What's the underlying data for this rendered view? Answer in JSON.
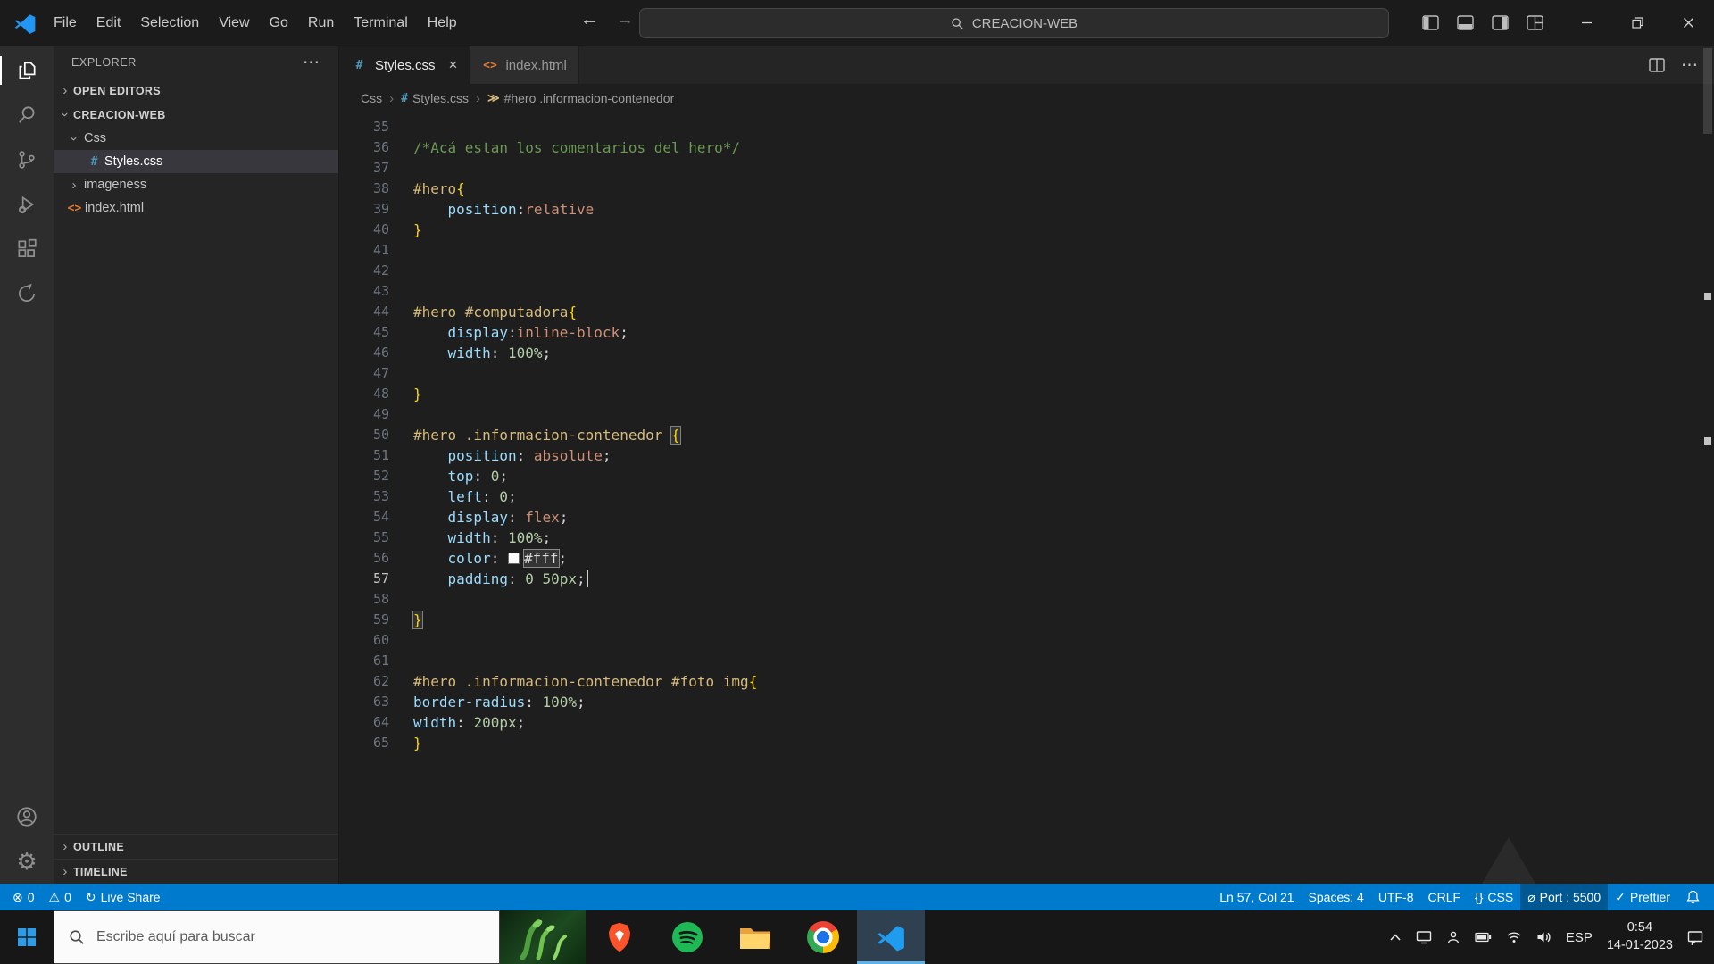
{
  "colors": {
    "status_blue": "#007acc",
    "css_blue": "#519aba",
    "html_orange": "#e37933",
    "selection_gray": "#37373d"
  },
  "icons": {
    "chevron": "›",
    "more": "⋯",
    "close": "×",
    "arrow_left": "←",
    "arrow_right": "→",
    "gear": "⚙",
    "error": "⊗",
    "warning": "⚠",
    "live-share": "↻",
    "braces": "{}",
    "port": "⌀",
    "check": "✓",
    "css-file": "#",
    "html-file": "<>",
    "symbol": "≫"
  },
  "title_bar": {
    "menus": [
      "File",
      "Edit",
      "Selection",
      "View",
      "Go",
      "Run",
      "Terminal",
      "Help"
    ],
    "search_label": "CREACION-WEB"
  },
  "sidebar": {
    "title": "EXPLORER",
    "open_editors_label": "OPEN EDITORS",
    "workspace_label": "CREACION-WEB",
    "tree": [
      {
        "label": "Css",
        "kind": "folder",
        "chevron": "down",
        "depth": 1
      },
      {
        "label": "Styles.css",
        "kind": "css",
        "depth": 2,
        "selected": true
      },
      {
        "label": "imageness",
        "kind": "folder",
        "chevron": "right",
        "depth": 1
      },
      {
        "label": "index.html",
        "kind": "html",
        "depth": 1
      }
    ],
    "bottom_sections": [
      "OUTLINE",
      "TIMELINE"
    ]
  },
  "editor": {
    "tabs": [
      {
        "label": "Styles.css",
        "icon": "css",
        "active": true
      },
      {
        "label": "index.html",
        "icon": "html",
        "active": false
      }
    ],
    "breadcrumb": [
      {
        "label": "Css"
      },
      {
        "label": "Styles.css",
        "icon": "css"
      },
      {
        "label": "#hero .informacion-contenedor",
        "icon": "symbol"
      }
    ],
    "code_lines": [
      {
        "n": 35,
        "tokens": []
      },
      {
        "n": 36,
        "tokens": [
          {
            "s": "cm",
            "t": "/*Acá estan los comentarios del hero*/"
          }
        ]
      },
      {
        "n": 37,
        "tokens": []
      },
      {
        "n": 38,
        "tokens": [
          {
            "s": "sel",
            "t": "#hero"
          },
          {
            "s": "brace",
            "t": "{"
          }
        ]
      },
      {
        "n": 39,
        "tokens": [
          {
            "s": "pln",
            "t": "    "
          },
          {
            "s": "prop",
            "t": "position"
          },
          {
            "s": "punc",
            "t": ":"
          },
          {
            "s": "val",
            "t": "relative"
          }
        ]
      },
      {
        "n": 40,
        "tokens": [
          {
            "s": "brace",
            "t": "}"
          }
        ]
      },
      {
        "n": 41,
        "tokens": []
      },
      {
        "n": 42,
        "tokens": []
      },
      {
        "n": 43,
        "tokens": []
      },
      {
        "n": 44,
        "tokens": [
          {
            "s": "sel",
            "t": "#hero #computadora"
          },
          {
            "s": "brace",
            "t": "{"
          }
        ]
      },
      {
        "n": 45,
        "tokens": [
          {
            "s": "pln",
            "t": "    "
          },
          {
            "s": "prop",
            "t": "display"
          },
          {
            "s": "punc",
            "t": ":"
          },
          {
            "s": "val",
            "t": "inline-block"
          },
          {
            "s": "punc",
            "t": ";"
          }
        ]
      },
      {
        "n": 46,
        "tokens": [
          {
            "s": "pln",
            "t": "    "
          },
          {
            "s": "prop",
            "t": "width"
          },
          {
            "s": "punc",
            "t": ": "
          },
          {
            "s": "num",
            "t": "100%"
          },
          {
            "s": "punc",
            "t": ";"
          }
        ]
      },
      {
        "n": 47,
        "tokens": []
      },
      {
        "n": 48,
        "tokens": [
          {
            "s": "brace",
            "t": "}"
          }
        ]
      },
      {
        "n": 49,
        "tokens": []
      },
      {
        "n": 50,
        "tokens": [
          {
            "s": "sel",
            "t": "#hero .informacion-contenedor "
          },
          {
            "s": "brm",
            "t": "{"
          }
        ]
      },
      {
        "n": 51,
        "tokens": [
          {
            "s": "pln",
            "t": "    "
          },
          {
            "s": "prop",
            "t": "position"
          },
          {
            "s": "punc",
            "t": ": "
          },
          {
            "s": "val",
            "t": "absolute"
          },
          {
            "s": "punc",
            "t": ";"
          }
        ]
      },
      {
        "n": 52,
        "tokens": [
          {
            "s": "pln",
            "t": "    "
          },
          {
            "s": "prop",
            "t": "top"
          },
          {
            "s": "punc",
            "t": ": "
          },
          {
            "s": "num",
            "t": "0"
          },
          {
            "s": "punc",
            "t": ";"
          }
        ]
      },
      {
        "n": 53,
        "tokens": [
          {
            "s": "pln",
            "t": "    "
          },
          {
            "s": "prop",
            "t": "left"
          },
          {
            "s": "punc",
            "t": ": "
          },
          {
            "s": "num",
            "t": "0"
          },
          {
            "s": "punc",
            "t": ";"
          }
        ]
      },
      {
        "n": 54,
        "tokens": [
          {
            "s": "pln",
            "t": "    "
          },
          {
            "s": "prop",
            "t": "display"
          },
          {
            "s": "punc",
            "t": ": "
          },
          {
            "s": "val",
            "t": "flex"
          },
          {
            "s": "punc",
            "t": ";"
          }
        ]
      },
      {
        "n": 55,
        "tokens": [
          {
            "s": "pln",
            "t": "    "
          },
          {
            "s": "prop",
            "t": "width"
          },
          {
            "s": "punc",
            "t": ": "
          },
          {
            "s": "num",
            "t": "100%"
          },
          {
            "s": "punc",
            "t": ";"
          }
        ]
      },
      {
        "n": 56,
        "tokens": [
          {
            "s": "pln",
            "t": "    "
          },
          {
            "s": "prop",
            "t": "color"
          },
          {
            "s": "punc",
            "t": ": "
          },
          {
            "s": "swatch",
            "t": ""
          },
          {
            "s": "hl",
            "t": "#fff"
          },
          {
            "s": "punc",
            "t": ";"
          }
        ]
      },
      {
        "n": 57,
        "active": true,
        "cursor": true,
        "tokens": [
          {
            "s": "pln",
            "t": "    "
          },
          {
            "s": "prop",
            "t": "padding"
          },
          {
            "s": "punc",
            "t": ": "
          },
          {
            "s": "num",
            "t": "0 50px"
          },
          {
            "s": "punc",
            "t": ";"
          }
        ]
      },
      {
        "n": 58,
        "tokens": []
      },
      {
        "n": 59,
        "tokens": [
          {
            "s": "brm",
            "t": "}"
          }
        ]
      },
      {
        "n": 60,
        "tokens": []
      },
      {
        "n": 61,
        "tokens": []
      },
      {
        "n": 62,
        "tokens": [
          {
            "s": "sel",
            "t": "#hero .informacion-contenedor #foto img"
          },
          {
            "s": "brace",
            "t": "{"
          }
        ]
      },
      {
        "n": 63,
        "tokens": [
          {
            "s": "prop",
            "t": "border-radius"
          },
          {
            "s": "punc",
            "t": ": "
          },
          {
            "s": "num",
            "t": "100%"
          },
          {
            "s": "punc",
            "t": ";"
          }
        ]
      },
      {
        "n": 64,
        "tokens": [
          {
            "s": "prop",
            "t": "width"
          },
          {
            "s": "punc",
            "t": ": "
          },
          {
            "s": "num",
            "t": "200px"
          },
          {
            "s": "punc",
            "t": ";"
          }
        ]
      },
      {
        "n": 65,
        "tokens": [
          {
            "s": "brace",
            "t": "}"
          }
        ]
      }
    ]
  },
  "status_bar": {
    "left": [
      {
        "name": "errors",
        "icon": "error",
        "label": "0"
      },
      {
        "name": "warnings",
        "icon": "warning",
        "label": "0"
      },
      {
        "name": "live-share",
        "icon": "live-share",
        "label": "Live Share"
      }
    ],
    "right": [
      {
        "name": "line-col",
        "label": "Ln 57, Col 21"
      },
      {
        "name": "indentation",
        "label": "Spaces: 4"
      },
      {
        "name": "encoding",
        "label": "UTF-8"
      },
      {
        "name": "eol",
        "label": "CRLF"
      },
      {
        "name": "language-mode",
        "icon": "braces",
        "label": "CSS"
      },
      {
        "name": "live-server-port",
        "icon": "port",
        "label": "Port : 5500",
        "highlight": true
      },
      {
        "name": "prettier",
        "icon": "check",
        "label": "Prettier"
      }
    ]
  },
  "taskbar": {
    "search_placeholder": "Escribe aquí para buscar",
    "tray": {
      "language": "ESP",
      "time": "0:54",
      "date": "14-01-2023"
    }
  }
}
